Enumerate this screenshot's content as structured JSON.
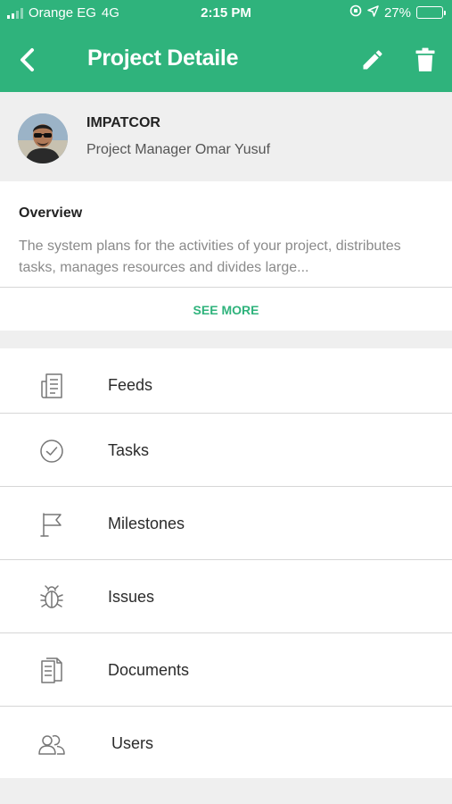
{
  "status_bar": {
    "carrier": "Orange EG",
    "network": "4G",
    "time": "2:15 PM",
    "battery": "27%",
    "battery_level": 0.27
  },
  "navbar": {
    "title": "Project Detaile",
    "back_icon": "chevron-left-icon",
    "edit_icon": "pencil-icon",
    "delete_icon": "trash-icon"
  },
  "project": {
    "company": "IMPATCOR",
    "manager_line": "Project Manager Omar Yusuf"
  },
  "overview": {
    "title": "Overview",
    "text": "The system plans for the activities of your project, distributes tasks, manages resources and divides large...",
    "see_more": "SEE MORE"
  },
  "menu": [
    {
      "label": "Feeds",
      "icon": "feed-document-icon"
    },
    {
      "label": "Tasks",
      "icon": "check-circle-icon"
    },
    {
      "label": "Milestones",
      "icon": "flag-icon"
    },
    {
      "label": "Issues",
      "icon": "bug-icon"
    },
    {
      "label": "Documents",
      "icon": "documents-icon"
    },
    {
      "label": "Users",
      "icon": "users-icon"
    }
  ],
  "colors": {
    "accent": "#2fb37c",
    "background": "#efefef",
    "text": "#2b2b2b",
    "muted_text": "#8a8a8a",
    "icon": "#777777"
  }
}
